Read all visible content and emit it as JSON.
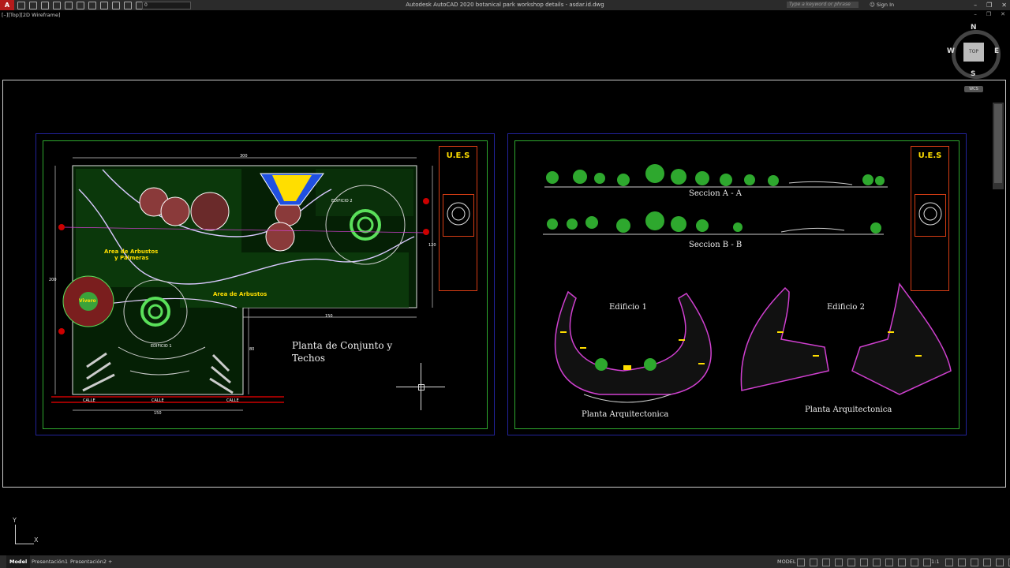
{
  "app": {
    "logo": "A",
    "window_title": "Autodesk AutoCAD 2020   botanical park workshop details - asdar.id.dwg",
    "layer": "0",
    "search_placeholder": "Type a keyword or phrase",
    "sign_in": "Sign In",
    "view_label": "[–][Top][2D Wireframe]"
  },
  "viewcube": {
    "north": "N",
    "south": "S",
    "east": "E",
    "west": "W",
    "face": "TOP",
    "wcs": "WCS"
  },
  "ucs": {
    "y": "Y",
    "x": "X"
  },
  "drawing": {
    "left_title_line1": "Planta de Conjunto y",
    "left_title_line2": "Techos",
    "ues": "U.E.S",
    "section_a": "Seccion A - A",
    "section_b": "Seccion B - B",
    "edificio1": "Edificio 1",
    "edificio2": "Edificio 2",
    "planta_arq1": "Planta Arquitectonica",
    "planta_arq2": "Planta Arquitectonica",
    "area_arbustos_palmeras_1": "Area de Arbustos",
    "area_arbustos_palmeras_2": "y Palmeras",
    "area_arbustos": "Area de Arbustos",
    "vivero": "Vivero",
    "edificio_1_label": "EDIFICIO 1",
    "edificio_2_label": "EDIFICIO 2",
    "calle": "CALLE",
    "dim_300": "300",
    "dim_150": "150",
    "dim_200": "200",
    "dim_120": "120",
    "dim_80": "80"
  },
  "status": {
    "tabs": [
      "Model",
      "Presentación1",
      "Presentación2"
    ],
    "add_tab": "+",
    "model": "MODEL",
    "scale": "1:1"
  }
}
